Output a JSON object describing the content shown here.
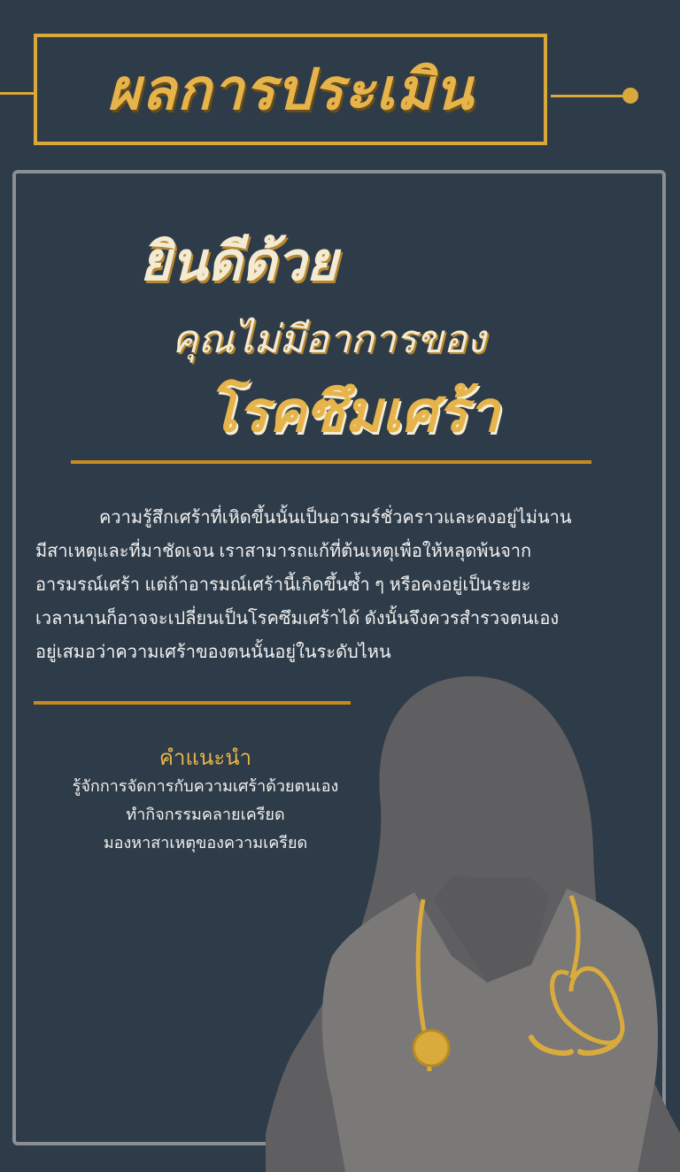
{
  "header": {
    "title": "ผลการประเมิน",
    "accent_color": "#d9a83a"
  },
  "result": {
    "congrats": "ยินดีด้วย",
    "no_symptoms": "คุณไม่มีอาการของ",
    "disease": "โรคซึมเศร้า"
  },
  "description": "ความรู้สึกเศร้าที่เหิดขึ้นนั้นเป็นอารมร์ชั่วคราวและคงอยู่ไม่นาน\nมีสาเหตุและที่มาชัดเจน เราสามารถแก้ที่ต้นเหตุเพื่อให้หลุดพ้นจาก\nอารมรณ์เศร้า แต่ถ้าอารมณ์เศร้านี้เกิดขึ้นซ้ำ ๆ หรือคงอยู่เป็นระยะ\nเวลานานก็อาจจะเปลี่ยนเป็นโรคซึมเศร้าได้ ดังนั้นจึงควรสำรวจตนเอง\nอยู่เสมอว่าความเศร้าของตนนั้นอยู่ในระดับไหน",
  "advice": {
    "title": "คำแนะนำ",
    "items": [
      "รู้จักการจัดการกับความเศร้าด้วยตนเอง",
      "ทำกิจกรรมคลายเครียด",
      "มองหาสาเหตุของความเครียด"
    ]
  },
  "illustration": {
    "icon": "doctor-silhouette-with-stethoscope",
    "colors": {
      "hair": "#5f5f62",
      "coat": "#7b7878",
      "stethoscope": "#d9ab3c"
    }
  }
}
